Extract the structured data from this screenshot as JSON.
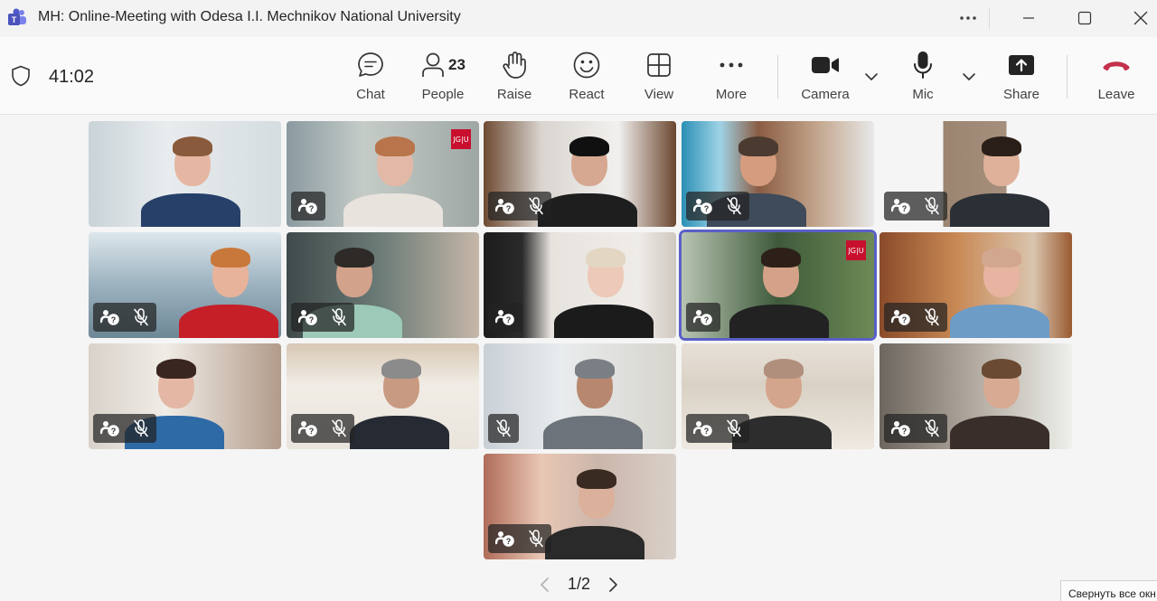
{
  "window": {
    "title": "MH: Online-Meeting with Odesa I.I. Mechnikov National University"
  },
  "toolbar": {
    "timer": "41:02",
    "chat_label": "Chat",
    "people_label": "People",
    "people_count": "23",
    "raise_label": "Raise",
    "react_label": "React",
    "view_label": "View",
    "more_label": "More",
    "camera_label": "Camera",
    "mic_label": "Mic",
    "share_label": "Share",
    "leave_label": "Leave"
  },
  "participants": [
    {
      "slot": 1,
      "muted": false,
      "warning": false,
      "badge": ""
    },
    {
      "slot": 2,
      "muted": false,
      "warning": true,
      "badge": "JG|U"
    },
    {
      "slot": 3,
      "muted": true,
      "warning": true,
      "badge": ""
    },
    {
      "slot": 4,
      "muted": true,
      "warning": true,
      "badge": ""
    },
    {
      "slot": 5,
      "muted": true,
      "warning": true,
      "badge": ""
    },
    {
      "slot": 6,
      "muted": true,
      "warning": true,
      "badge": ""
    },
    {
      "slot": 7,
      "muted": true,
      "warning": true,
      "badge": ""
    },
    {
      "slot": 8,
      "muted": false,
      "warning": true,
      "badge": ""
    },
    {
      "slot": 9,
      "muted": false,
      "warning": true,
      "badge": "JG|U",
      "active_speaker": true
    },
    {
      "slot": 10,
      "muted": true,
      "warning": true,
      "badge": ""
    },
    {
      "slot": 11,
      "muted": true,
      "warning": true,
      "badge": ""
    },
    {
      "slot": 12,
      "muted": true,
      "warning": true,
      "badge": ""
    },
    {
      "slot": 13,
      "muted": true,
      "warning": false,
      "badge": ""
    },
    {
      "slot": 14,
      "muted": true,
      "warning": true,
      "badge": ""
    },
    {
      "slot": 15,
      "muted": true,
      "warning": true,
      "badge": ""
    },
    {
      "slot": 16,
      "muted": true,
      "warning": true,
      "badge": ""
    }
  ],
  "pager": {
    "text": "1/2"
  },
  "tooltip": {
    "text": "Свернуть все окн"
  },
  "colors": {
    "accent": "#5b5fc7",
    "leave": "#c4314b",
    "brand_badge": "#c8102e"
  }
}
